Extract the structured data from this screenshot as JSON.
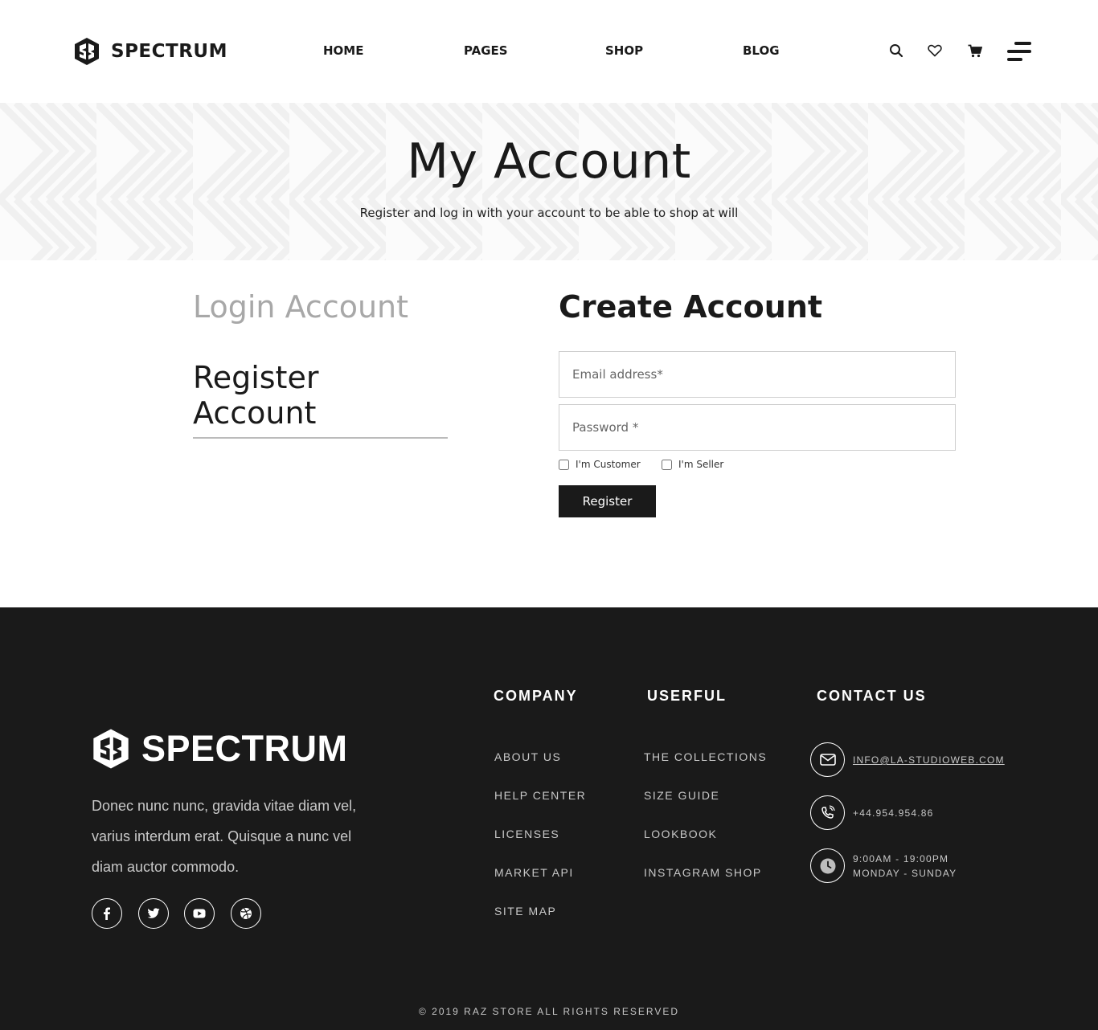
{
  "header": {
    "brand": "SPECTRUM",
    "nav": [
      {
        "label": "HOME"
      },
      {
        "label": "PAGES"
      },
      {
        "label": "SHOP"
      },
      {
        "label": "BLOG"
      }
    ],
    "icons": [
      "search-icon",
      "heart-icon",
      "cart-icon",
      "menu-icon"
    ]
  },
  "hero": {
    "title": "My Account",
    "subtitle": "Register and log in with your account to be able to shop at will"
  },
  "tabs": {
    "login": "Login Account",
    "register": "Register Account",
    "active": "register"
  },
  "form": {
    "title": "Create Account",
    "email_placeholder": "Email address*",
    "email_value": "",
    "password_placeholder": "Password *",
    "password_value": "",
    "customer_label": "I'm Customer",
    "customer_checked": false,
    "seller_label": "I'm Seller",
    "seller_checked": false,
    "submit_label": "Register"
  },
  "footer": {
    "brand": "SPECTRUM",
    "about": "Donec nunc nunc, gravida vitae diam vel, varius interdum erat. Quisque a nunc vel diam auctor commodo.",
    "social": [
      "facebook-icon",
      "twitter-icon",
      "youtube-icon",
      "dribbble-icon"
    ],
    "company": {
      "heading": "COMPANY",
      "links": [
        "ABOUT US",
        "HELP CENTER",
        "LICENSES",
        "MARKET API",
        "SITE MAP"
      ]
    },
    "userful": {
      "heading": "USERFUL",
      "links": [
        "THE COLLECTIONS",
        "SIZE GUIDE",
        "LOOKBOOK",
        "INSTAGRAM SHOP"
      ]
    },
    "contact": {
      "heading": "CONTACT US",
      "email": "INFO@LA-STUDIOWEB.COM",
      "phone": "+44.954.954.86",
      "hours_time": "9:00AM - 19:00PM",
      "hours_days": "MONDAY - SUNDAY"
    },
    "copyright": "© 2019 RAZ STORE ALL RIGHTS RESERVED"
  },
  "colors": {
    "dark": "#1a1a1a",
    "muted_tab": "#a8a8a8",
    "footer_text": "#c8c8c8"
  }
}
